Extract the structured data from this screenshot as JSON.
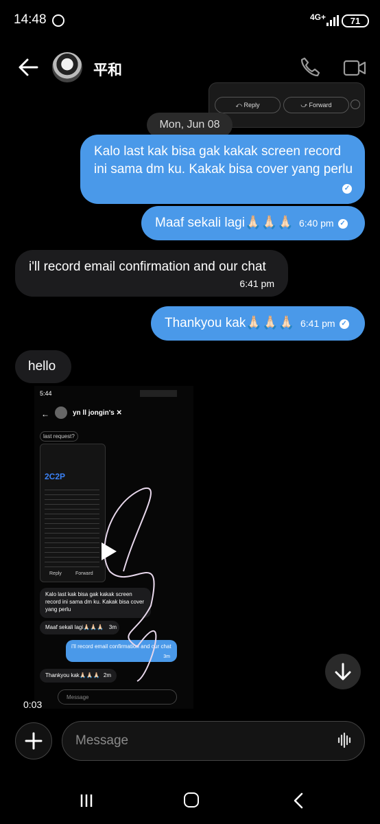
{
  "status_bar": {
    "time": "14:48",
    "network": "4G+",
    "battery": "71"
  },
  "header": {
    "contact_name": "平和"
  },
  "quoted_card": {
    "reply_label": "Reply",
    "forward_label": "Forward"
  },
  "date_separator": "Mon, Jun 08",
  "messages": [
    {
      "text": "Kalo last kak bisa gak kakak screen record ini sama dm ku. Kakak bisa cover yang perlu",
      "time": ""
    },
    {
      "text": "Maaf sekali lagi🙏🏻🙏🏻🙏🏻",
      "time": "6:40 pm"
    },
    {
      "text": "i'll record email confirmation and our chat",
      "time": "6:41 pm"
    },
    {
      "text": "Thankyou kak🙏🏻🙏🏻🙏🏻",
      "time": "6:41 pm"
    },
    {
      "text": "hello",
      "time": ""
    }
  ],
  "video": {
    "duration": "0:03",
    "inner": {
      "time": "5:44",
      "contact": "yn ll jongin's ✕",
      "last_request": "last request?",
      "brand": "2C2P",
      "msg1": "Kalo last kak bisa gak kakak screen record ini sama dm ku. Kakak bisa cover yang perlu",
      "msg2": "Maaf sekali lagi🙏🏻🙏🏻🙏🏻",
      "msg2_time": "3m",
      "msg3": "i'll record email confirmation and our chat",
      "msg3_time": "3m",
      "msg4": "Thankyou kak🙏🏻🙏🏻🙏🏻",
      "msg4_time": "2m",
      "placeholder": "Message",
      "reply": "Reply",
      "forward": "Forward"
    }
  },
  "composer": {
    "placeholder": "Message"
  },
  "colors": {
    "outgoing_bubble": "#4a99e9",
    "incoming_bubble": "#1c1c1e",
    "background": "#000000"
  }
}
